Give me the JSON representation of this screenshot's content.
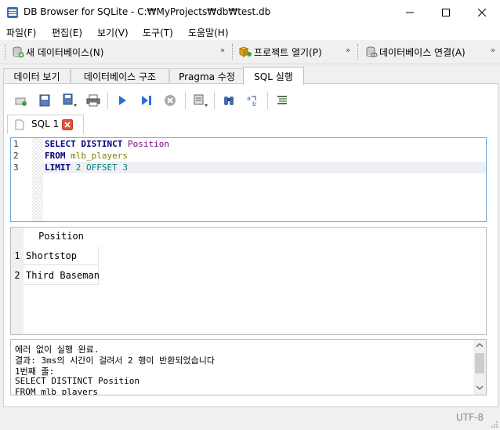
{
  "window": {
    "title": "DB Browser for SQLite - C:₩MyProjects₩db₩test.db"
  },
  "menu": [
    "파일(F)",
    "편집(E)",
    "보기(V)",
    "도구(T)",
    "도움말(H)"
  ],
  "toolbar": {
    "new_db": "새 데이터베이스(N)",
    "open_project": "프로젝트 열기(P)",
    "connect_db": "데이터베이스 연결(A)"
  },
  "tabs": [
    "데이터 보기",
    "데이터베이스 구조",
    "Pragma 수정",
    "SQL 실행"
  ],
  "editor": {
    "tab_label": "SQL 1",
    "line_numbers": [
      "1",
      "2",
      "3"
    ],
    "lines": [
      {
        "kw": "SELECT DISTINCT ",
        "rest": "Position",
        "rest_class": "id"
      },
      {
        "kw": "FROM ",
        "rest": "mlb_players",
        "rest_class": "id2"
      },
      {
        "kw": "LIMIT ",
        "rest": "2 OFFSET 3",
        "rest_class": "num"
      }
    ]
  },
  "results": {
    "column": "Position",
    "rows": [
      {
        "num": "1",
        "value": "Shortstop"
      },
      {
        "num": "2",
        "value": "Third Baseman"
      }
    ]
  },
  "message": [
    "에러 없이 실행 완료.",
    "결과: 3ms의 시간이 걸려서 2 행이 반환되었습니다",
    "1번째 줄:",
    "SELECT DISTINCT Position",
    "FROM mlb_players"
  ],
  "status": {
    "encoding": "UTF-8"
  }
}
